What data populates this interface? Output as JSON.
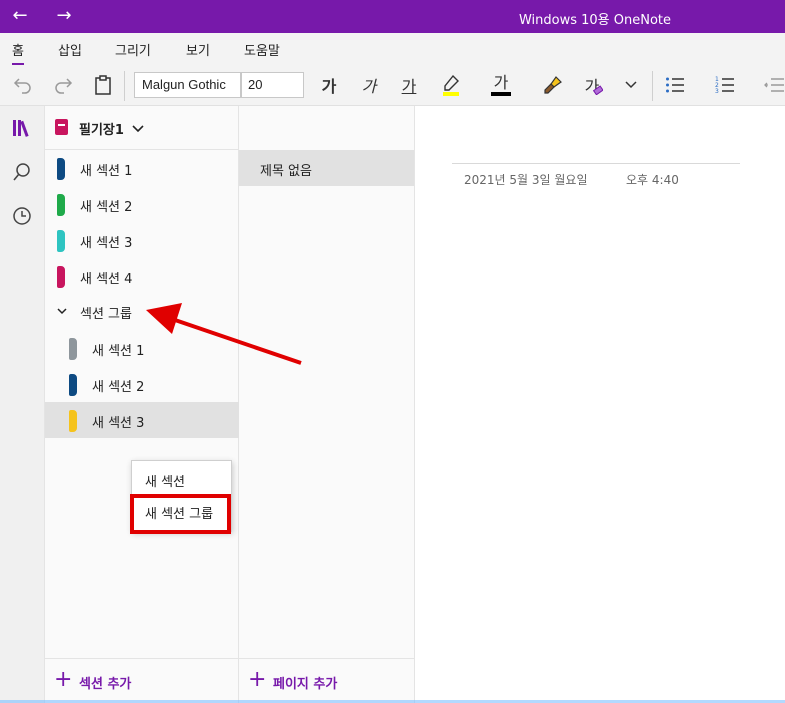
{
  "window": {
    "title": "Windows 10용 OneNote",
    "back_icon": "←",
    "forward_icon": "→"
  },
  "menu": {
    "tabs": [
      "홈",
      "삽입",
      "그리기",
      "보기",
      "도움말"
    ]
  },
  "toolbar": {
    "font_name": "Malgun Gothic",
    "font_size": "20",
    "bold_glyph": "가",
    "italic_glyph": "가",
    "underline_glyph": "가",
    "font_color_glyph": "가",
    "format_painter_glyph": "가",
    "highlight_color": "#ffff00",
    "font_color": "#000000"
  },
  "notebook": {
    "name": "필기장1",
    "sections": [
      {
        "label": "새 섹션 1",
        "color": "#0d4a82"
      },
      {
        "label": "새 섹션 2",
        "color": "#1faa4a"
      },
      {
        "label": "새 섹션 3",
        "color": "#2ec4c1"
      },
      {
        "label": "새 섹션 4",
        "color": "#c8155e"
      }
    ],
    "group": {
      "label": "섹션 그룹",
      "sections": [
        {
          "label": "새 섹션 1",
          "color": "#8e969c"
        },
        {
          "label": "새 섹션 2",
          "color": "#0d4a82"
        },
        {
          "label": "새 섹션 3",
          "color": "#f5c31d"
        }
      ]
    },
    "add_section_label": "섹션 추가"
  },
  "pages": {
    "items": [
      "제목 없음"
    ],
    "add_page_label": "페이지 추가"
  },
  "canvas": {
    "date": "2021년 5월 3일 월요일",
    "time": "오후 4:40"
  },
  "context_menu": {
    "items": [
      "새 섹션",
      "새 섹션 그룹"
    ]
  },
  "colors": {
    "accent": "#7719aa",
    "annotation_red": "#e00000"
  }
}
